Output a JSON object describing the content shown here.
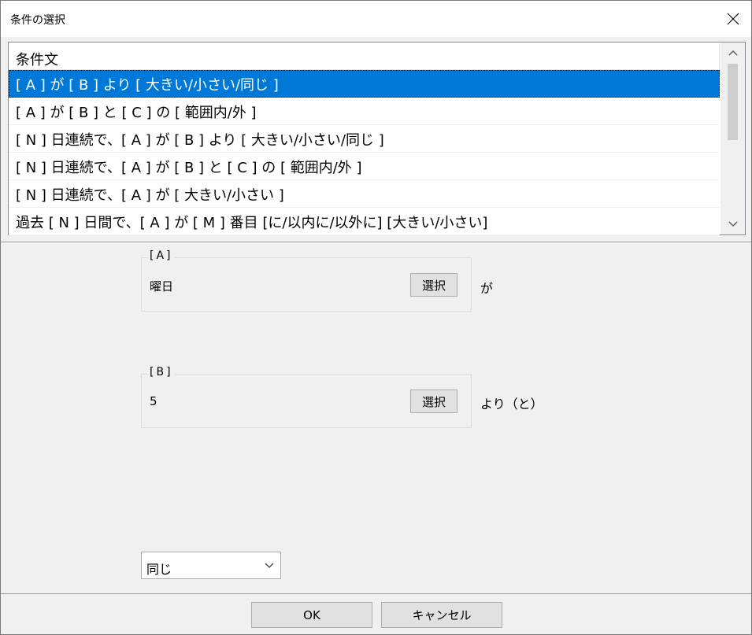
{
  "window": {
    "title": "条件の選択",
    "close_icon": "close-icon"
  },
  "condition_list": {
    "column_header": "条件文",
    "selected_index": 0,
    "rows": [
      "[ A ] が [ B ] より [ 大きい/小さい/同じ ]",
      "[ A ] が [ B ] と [ C ] の [ 範囲内/外 ]",
      "[ N ] 日連続で、[ A ] が [ B ] より [ 大きい/小さい/同じ ]",
      "[ N ] 日連続で、[ A ] が [ B ] と [ C ] の [ 範囲内/外 ]",
      "[ N ] 日連続で、[ A ] が [ 大きい/小さい ]",
      "過去 [ N ] 日間で、[ A ] が [ M ] 番目 [に/以内に/以外に] [大きい/小さい]"
    ]
  },
  "param_a": {
    "legend": "[A]",
    "value": "曜日",
    "button_label": "選択",
    "suffix": "が"
  },
  "param_b": {
    "legend": "[B]",
    "value": "5",
    "button_label": "選択",
    "suffix": "より（と）"
  },
  "comparison_dropdown": {
    "selected": "同じ"
  },
  "footer": {
    "ok_label": "OK",
    "cancel_label": "キャンセル"
  },
  "colors": {
    "selection": "#0078d7",
    "dialog_background": "#f0f0f0"
  }
}
